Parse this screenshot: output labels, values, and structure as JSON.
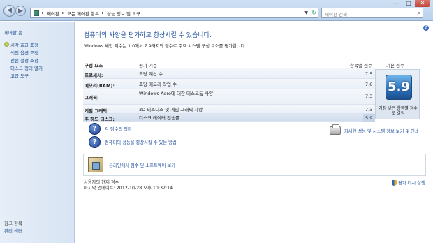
{
  "window": {
    "breadcrumb": [
      "제어판",
      "모든 제어판 항목",
      "성능 정보 및 도구"
    ],
    "search_placeholder": "제어판 검색",
    "controls": [
      "—",
      "□",
      "✕"
    ]
  },
  "sidebar": {
    "home": "제어판 홈",
    "items": [
      {
        "label": "시각 효과 조정",
        "icon": "shield-icon"
      },
      {
        "label": "색인 옵션 조정",
        "icon": ""
      },
      {
        "label": "전원 설정 조정",
        "icon": ""
      },
      {
        "label": "디스크 정리 열기",
        "icon": ""
      },
      {
        "label": "고급 도구",
        "icon": ""
      }
    ],
    "see_also": "참고 항목",
    "footer_link": "관리 센터"
  },
  "main": {
    "heading": "컴퓨터의 사양을 평가하고 향상시킬 수 있습니다.",
    "description": "Windows 체험 지수는 1.0에서 7.9까지의 점수로 주요 시스템 구성 요소를 평가합니다.",
    "table": {
      "col_component": "구성 요소",
      "col_rated": "평가 기준",
      "col_subscore": "항목별 점수",
      "col_base": "기본 점수",
      "rows": [
        {
          "name": "프로세서:",
          "desc": "초당 계산 수",
          "score": "7.5"
        },
        {
          "name": "메모리(RAM):",
          "desc": "초당 메모리 작업 수",
          "score": "7.6"
        },
        {
          "name": "그래픽:",
          "desc": "Windows Aero에 대한 데스크톱 사양",
          "score": "7.3"
        },
        {
          "name": "게임 그래픽:",
          "desc": "3D 비즈니스 및 게임 그래픽 사양",
          "score": "7.3"
        },
        {
          "name": "주 하드 디스크:",
          "desc": "디스크 데이터 전송률",
          "score": "5.9"
        }
      ]
    },
    "base_score": "5.9",
    "base_caption": "가장 낮은 항목별 점수로 결정",
    "links": {
      "what_mean": "각 점수의 의미",
      "improve": "컴퓨터의 성능을 향상시킬 수 있는 방법",
      "details": "자세한 성능 및 시스템 정보 보기 및 인쇄",
      "online": "온라인에서 점수 및 소프트웨어 보기",
      "rerun": "평가 다시 실행"
    },
    "current_score_label": "사용자의 현재 점수",
    "last_updated": "마지막 업데이트: 2012-10-28 오후 10:32:14"
  }
}
